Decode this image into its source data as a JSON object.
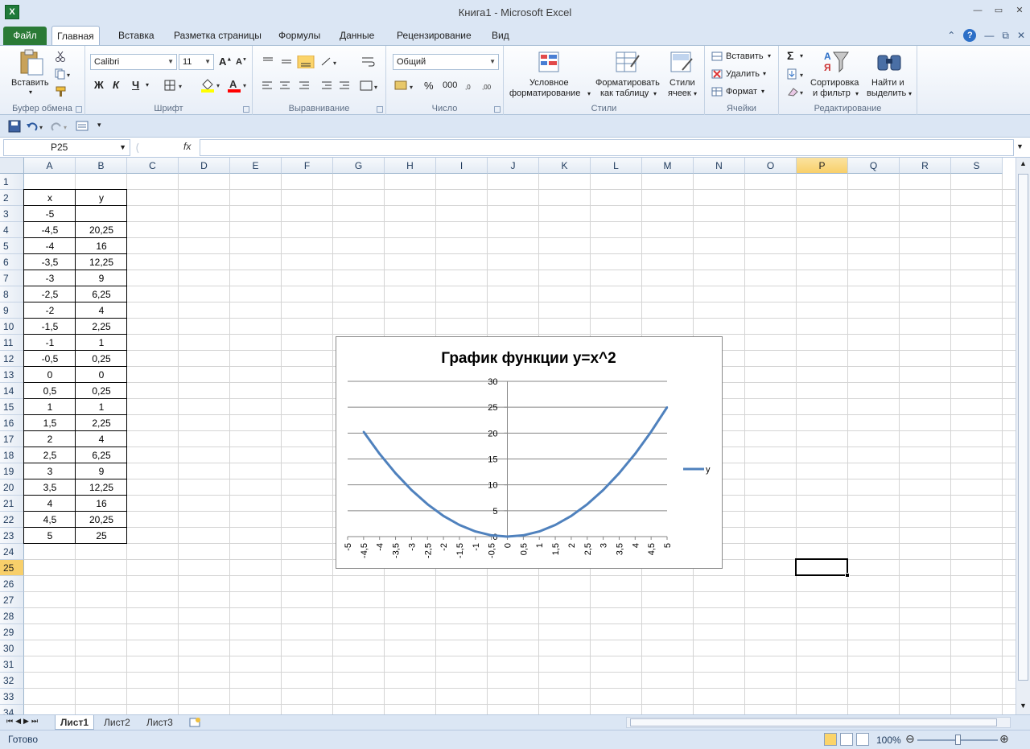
{
  "window": {
    "title": "Книга1  -  Microsoft Excel"
  },
  "tabs": {
    "file": "Файл",
    "items": [
      "Главная",
      "Вставка",
      "Разметка страницы",
      "Формулы",
      "Данные",
      "Рецензирование",
      "Вид"
    ]
  },
  "ribbon": {
    "clipboard": {
      "paste": "Вставить",
      "label": "Буфер обмена"
    },
    "font": {
      "name": "Calibri",
      "size": "11",
      "bold": "Ж",
      "italic": "К",
      "underline": "Ч",
      "label": "Шрифт"
    },
    "alignment": {
      "label": "Выравнивание"
    },
    "number": {
      "format": "Общий",
      "percent": "%",
      "thousands": "000",
      "label": "Число"
    },
    "styles": {
      "conditional1": "Условное",
      "conditional2": "форматирование",
      "table1": "Форматировать",
      "table2": "как таблицу",
      "cell1": "Стили",
      "cell2": "ячеек",
      "label": "Стили"
    },
    "cells": {
      "insert": "Вставить",
      "delete": "Удалить",
      "format": "Формат",
      "label": "Ячейки"
    },
    "editing": {
      "sigma": "Σ",
      "sort1": "Сортировка",
      "sort2": "и фильтр",
      "find1": "Найти и",
      "find2": "выделить",
      "label": "Редактирование"
    }
  },
  "formula_bar": {
    "name_box": "P25",
    "fx": "fx",
    "value": ""
  },
  "columns": [
    "A",
    "B",
    "C",
    "D",
    "E",
    "F",
    "G",
    "H",
    "I",
    "J",
    "K",
    "L",
    "M",
    "N",
    "O",
    "P",
    "Q",
    "R",
    "S"
  ],
  "selected": {
    "column": "P",
    "row": "25"
  },
  "rows": [
    "1",
    "2",
    "3",
    "4",
    "5",
    "6",
    "7",
    "8",
    "9",
    "10",
    "11",
    "12",
    "13",
    "14",
    "15",
    "16",
    "17",
    "18",
    "19",
    "20",
    "21",
    "22",
    "23",
    "24",
    "25",
    "26",
    "27",
    "28",
    "29",
    "30",
    "31",
    "32",
    "33",
    "34"
  ],
  "table": {
    "header": [
      "x",
      "y"
    ],
    "x": [
      "-5",
      "-4,5",
      "-4",
      "-3,5",
      "-3",
      "-2,5",
      "-2",
      "-1,5",
      "-1",
      "-0,5",
      "0",
      "0,5",
      "1",
      "1,5",
      "2",
      "2,5",
      "3",
      "3,5",
      "4",
      "4,5",
      "5"
    ],
    "y": [
      "",
      "20,25",
      "16",
      "12,25",
      "9",
      "6,25",
      "4",
      "2,25",
      "1",
      "0,25",
      "0",
      "0,25",
      "1",
      "2,25",
      "4",
      "6,25",
      "9",
      "12,25",
      "16",
      "20,25",
      "25"
    ]
  },
  "chart_data": {
    "type": "line",
    "title": "График функции y=x^2",
    "categories": [
      "-5",
      "-4,5",
      "-4",
      "-3,5",
      "-3",
      "-2,5",
      "-2",
      "-1,5",
      "-1",
      "-0,5",
      "0",
      "0,5",
      "1",
      "1,5",
      "2",
      "2,5",
      "3",
      "3,5",
      "4",
      "4,5",
      "5"
    ],
    "series": [
      {
        "name": "y",
        "values": [
          null,
          20.25,
          16,
          12.25,
          9,
          6.25,
          4,
          2.25,
          1,
          0.25,
          0,
          0.25,
          1,
          2.25,
          4,
          6.25,
          9,
          12.25,
          16,
          20.25,
          25
        ],
        "color": "#4f81bd"
      }
    ],
    "ylim": [
      0,
      30
    ],
    "yticks": [
      "0",
      "5",
      "10",
      "15",
      "20",
      "25",
      "30"
    ],
    "grid": true,
    "legend": "right"
  },
  "sheets": [
    "Лист1",
    "Лист2",
    "Лист3"
  ],
  "status": {
    "ready": "Готово",
    "zoom": "100%"
  }
}
